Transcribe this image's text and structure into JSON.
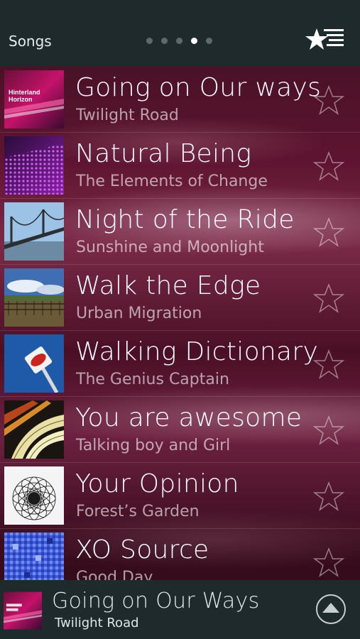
{
  "header": {
    "title": "Songs",
    "page_dots": 5,
    "active_dot": 3,
    "favorites_icon": "star-list-icon"
  },
  "songs": [
    {
      "title": "Going on Our ways",
      "artist": "Twilight Road",
      "art": "hinterland"
    },
    {
      "title": "Natural Being",
      "artist": "The Elements of Change",
      "art": "dots-purple"
    },
    {
      "title": "Night of the Ride",
      "artist": "Sunshine and Moonlight",
      "art": "bridge"
    },
    {
      "title": "Walk the Edge",
      "artist": "Urban Migration",
      "art": "landscape"
    },
    {
      "title": "Walking Dictionary",
      "artist": "The Genius Captain",
      "art": "sign"
    },
    {
      "title": "You are awesome",
      "artist": "Talking boy and Girl",
      "art": "abstract-yellow"
    },
    {
      "title": "Your Opinion",
      "artist": "Forest’s Garden",
      "art": "mandala"
    },
    {
      "title": "XO Source",
      "artist": "Good Day",
      "art": "blue-mosaic"
    }
  ],
  "now_playing": {
    "title": "Going on Our Ways",
    "artist": "Twilight Road",
    "expand_icon": "chevron-up-icon"
  },
  "colors": {
    "bar": "#1f2a2d",
    "accent": "#ffffff"
  }
}
